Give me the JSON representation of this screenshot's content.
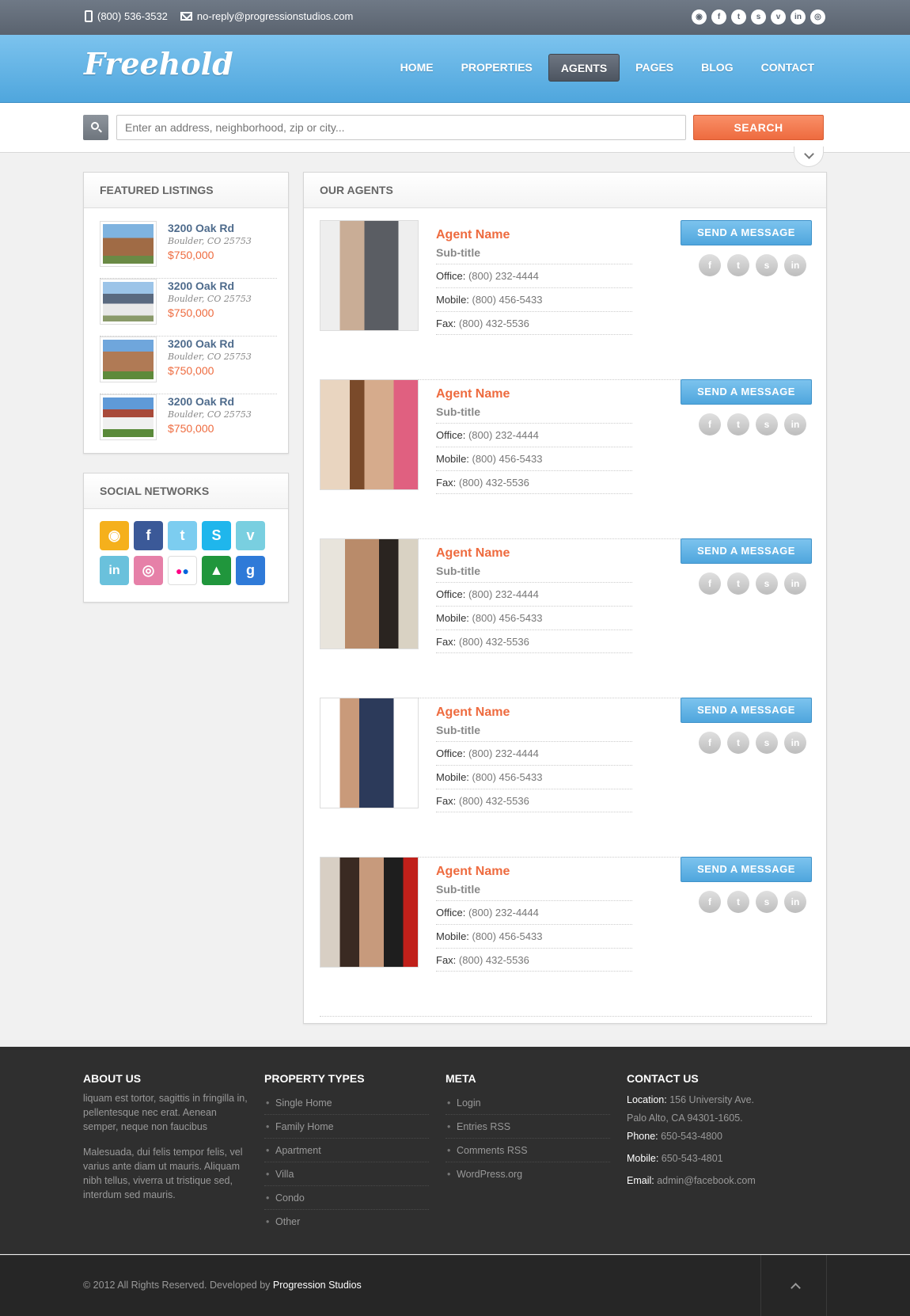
{
  "topbar": {
    "phone": "(800) 536-3532",
    "email": "no-reply@progressionstudios.com",
    "social": [
      "rss-icon",
      "facebook-icon",
      "twitter-icon",
      "skype-icon",
      "vimeo-icon",
      "linkedin-icon",
      "dribbble-icon"
    ]
  },
  "header": {
    "logo": "Freehold",
    "nav": [
      "HOME",
      "PROPERTIES",
      "AGENTS",
      "PAGES",
      "BLOG",
      "CONTACT"
    ],
    "active_nav": "AGENTS"
  },
  "search": {
    "placeholder": "Enter an address, neighborhood, zip or city...",
    "button": "SEARCH"
  },
  "featured": {
    "title": "FEATURED LISTINGS",
    "listings": [
      {
        "title": "3200 Oak Rd",
        "location": "Boulder, CO 25753",
        "price": "$750,000"
      },
      {
        "title": "3200 Oak Rd",
        "location": "Boulder, CO 25753",
        "price": "$750,000"
      },
      {
        "title": "3200 Oak Rd",
        "location": "Boulder, CO 25753",
        "price": "$750,000"
      },
      {
        "title": "3200 Oak Rd",
        "location": "Boulder, CO 25753",
        "price": "$750,000"
      }
    ]
  },
  "social_networks": {
    "title": "SOCIAL NETWORKS",
    "icons": [
      "rss-icon",
      "facebook-icon",
      "twitter-icon",
      "skype-icon",
      "vimeo-icon",
      "linkedin-icon",
      "dribbble-icon",
      "flickr-icon",
      "forrst-icon",
      "google-icon"
    ],
    "colors": {
      "rss": "#f5b01c",
      "facebook": "#3b5998",
      "twitter": "#7ccdf0",
      "skype": "#1fb6ec",
      "vimeo": "#79cfe0",
      "linkedin": "#6ac1dc",
      "dribbble": "#e680a8",
      "flickr": "#ffffff",
      "forrst": "#20963c",
      "google": "#2f7ad8"
    }
  },
  "agents_section": {
    "title": "OUR AGENTS",
    "agents": [
      {
        "name": "Agent Name",
        "subtitle": "Sub-title",
        "office_label": "Office:",
        "office": "(800) 232-4444",
        "mobile_label": "Mobile:",
        "mobile": "(800) 456-5433",
        "fax_label": "Fax:",
        "fax": "(800) 432-5536",
        "button": "SEND A MESSAGE"
      },
      {
        "name": "Agent Name",
        "subtitle": "Sub-title",
        "office_label": "Office:",
        "office": "(800) 232-4444",
        "mobile_label": "Mobile:",
        "mobile": "(800) 456-5433",
        "fax_label": "Fax:",
        "fax": "(800) 432-5536",
        "button": "SEND A MESSAGE"
      },
      {
        "name": "Agent Name",
        "subtitle": "Sub-title",
        "office_label": "Office:",
        "office": "(800) 232-4444",
        "mobile_label": "Mobile:",
        "mobile": "(800) 456-5433",
        "fax_label": "Fax:",
        "fax": "(800) 432-5536",
        "button": "SEND A MESSAGE"
      },
      {
        "name": "Agent Name",
        "subtitle": "Sub-title",
        "office_label": "Office:",
        "office": "(800) 232-4444",
        "mobile_label": "Mobile:",
        "mobile": "(800) 456-5433",
        "fax_label": "Fax:",
        "fax": "(800) 432-5536",
        "button": "SEND A MESSAGE"
      },
      {
        "name": "Agent Name",
        "subtitle": "Sub-title",
        "office_label": "Office:",
        "office": "(800) 232-4444",
        "mobile_label": "Mobile:",
        "mobile": "(800) 456-5433",
        "fax_label": "Fax:",
        "fax": "(800) 432-5536",
        "button": "SEND A MESSAGE"
      }
    ]
  },
  "footer": {
    "about": {
      "title": "ABOUT US",
      "p1": "liquam est tortor, sagittis in fringilla in, pellentesque nec erat. Aenean semper, neque non faucibus",
      "p2": "Malesuada, dui felis tempor felis, vel varius ante diam ut mauris. Aliquam nibh tellus, viverra ut tristique sed, interdum sed mauris."
    },
    "property_types": {
      "title": "PROPERTY TYPES",
      "items": [
        "Single Home",
        "Family Home",
        "Apartment",
        "Villa",
        "Condo",
        "Other"
      ]
    },
    "meta": {
      "title": "META",
      "items": [
        "Login",
        "Entries RSS",
        "Comments RSS",
        "WordPress.org"
      ]
    },
    "contact": {
      "title": "CONTACT US",
      "location_label": "Location:",
      "location1": "156 University Ave.",
      "location2": "Palo Alto, CA 94301-1605.",
      "phone_label": "Phone:",
      "phone": "650-543-4800",
      "mobile_label": "Mobile:",
      "mobile": "650-543-4801",
      "email_label": "Email:",
      "email": "admin@facebook.com"
    }
  },
  "bottom": {
    "copyright": "© 2012 All Rights Reserved. Developed by",
    "developer": "Progression Studios"
  }
}
